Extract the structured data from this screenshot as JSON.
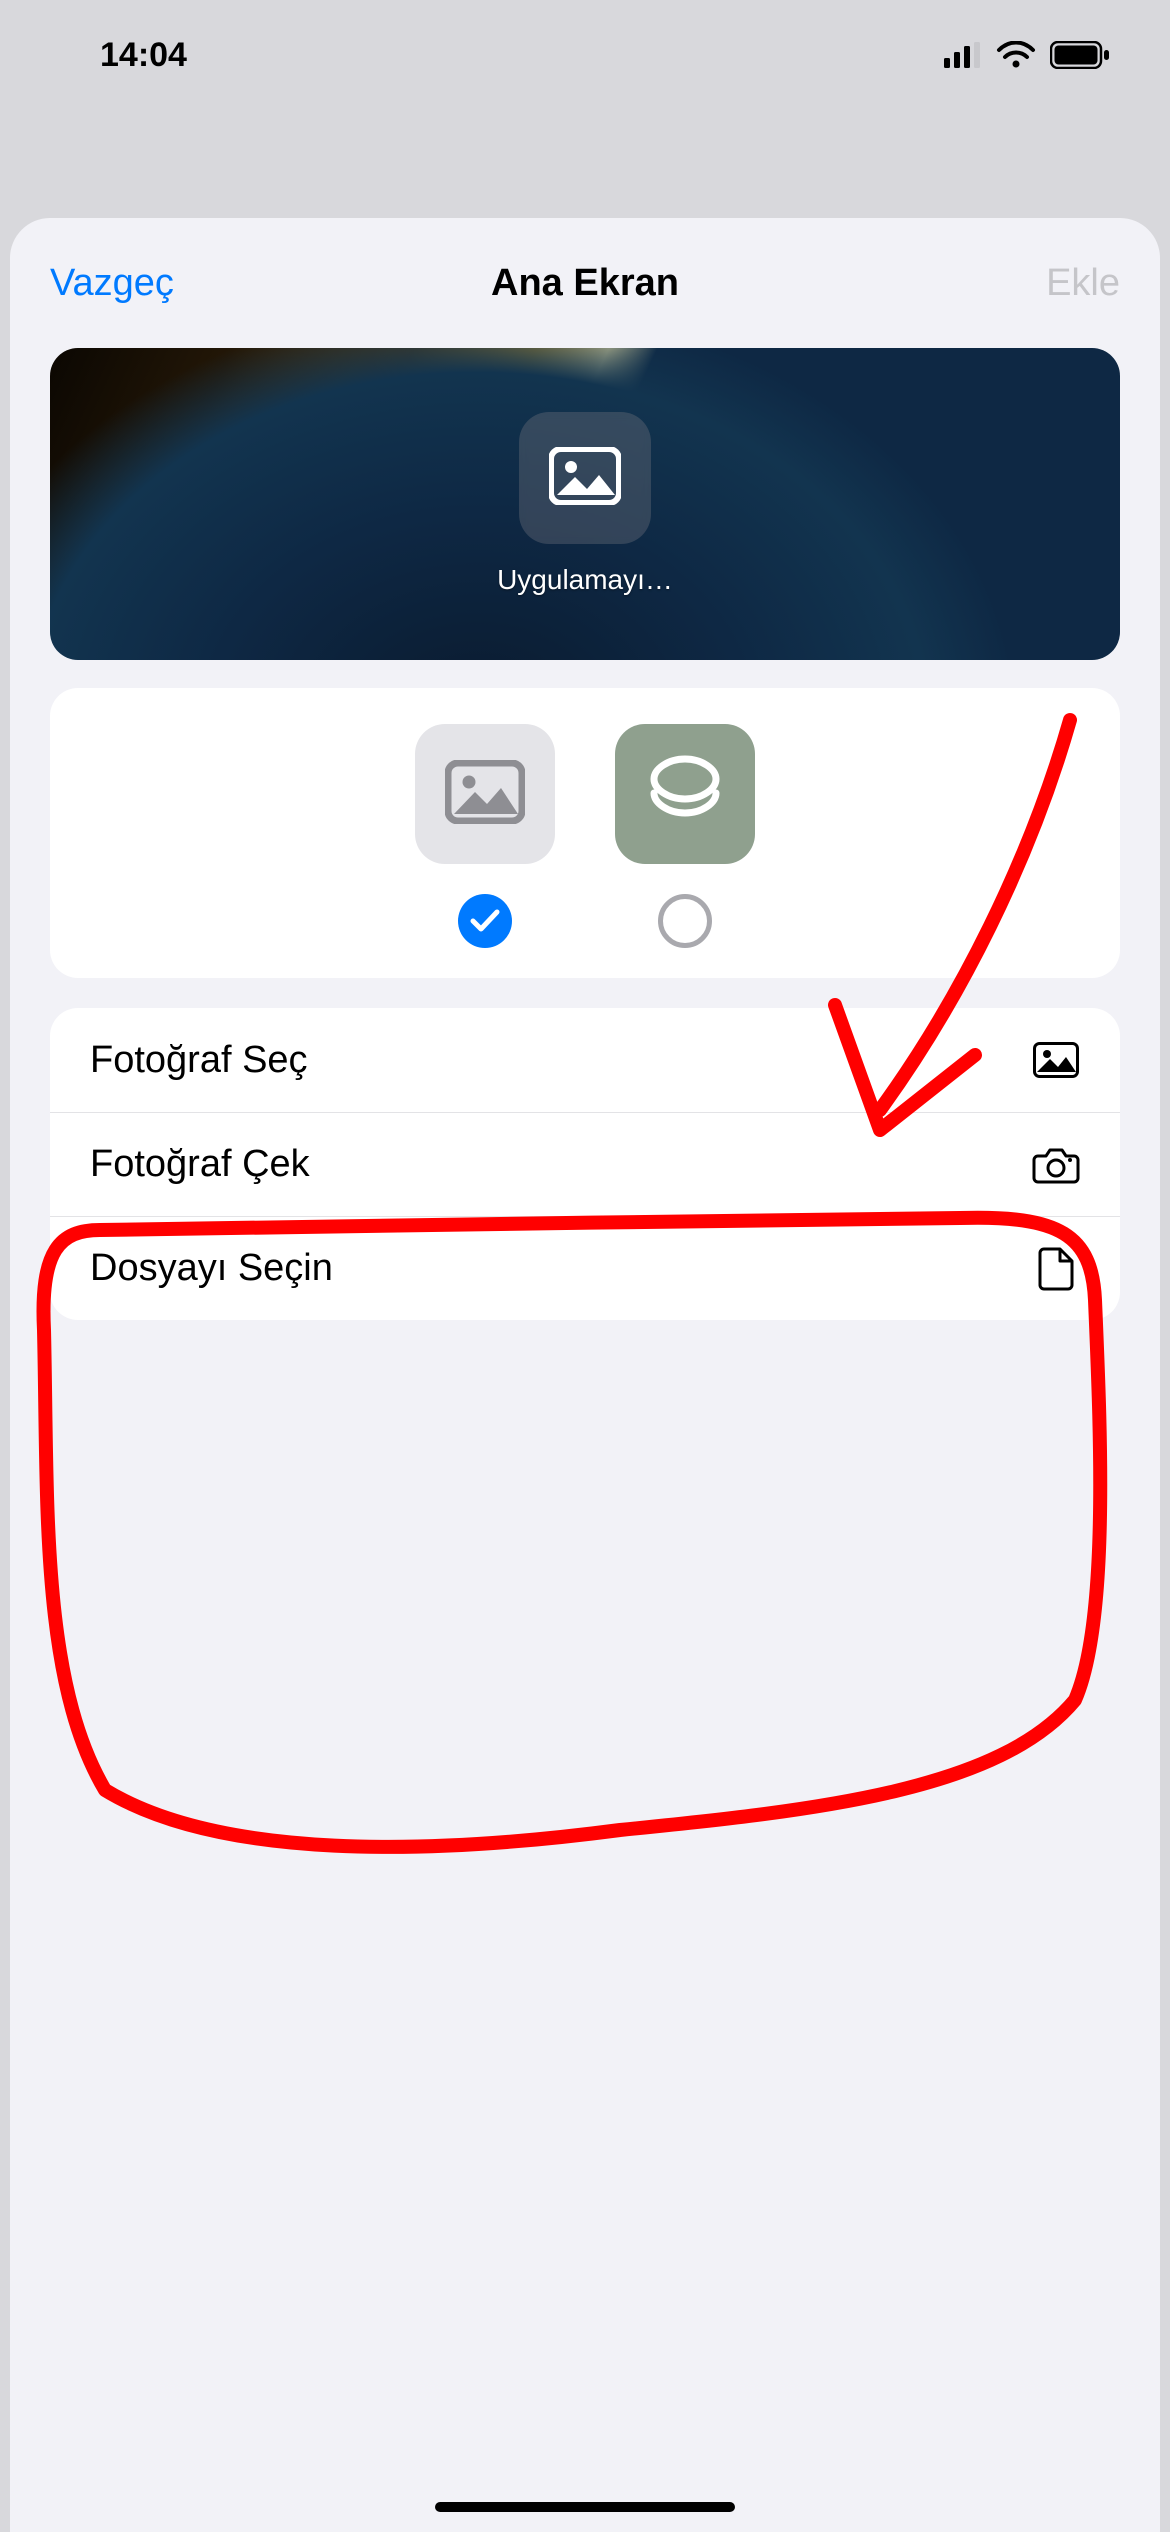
{
  "status": {
    "time": "14:04"
  },
  "nav": {
    "cancel": "Vazgeç",
    "title": "Ana Ekran",
    "add": "Ekle"
  },
  "preview": {
    "app_label": "Uygulamayı…"
  },
  "picker": {
    "options": [
      {
        "kind": "photo",
        "selected": true
      },
      {
        "kind": "shortcut",
        "selected": false
      }
    ]
  },
  "menu": {
    "choose_photo": "Fotoğraf Seç",
    "take_photo": "Fotoğraf Çek",
    "choose_file": "Dosyayı Seçin"
  },
  "colors": {
    "accent": "#007aff",
    "annotation": "#ff0000"
  }
}
